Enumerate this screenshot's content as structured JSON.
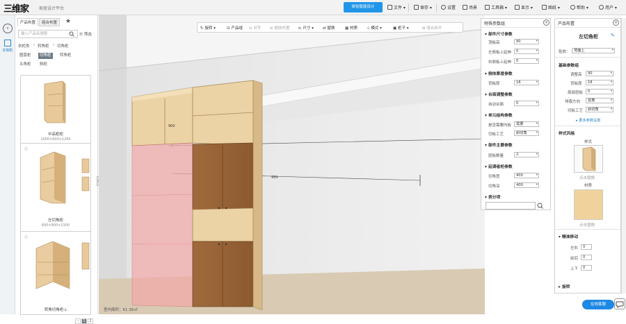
{
  "app": {
    "logo": "三维家",
    "subtitle": "家居设计平台",
    "cta": "体验智能设计"
  },
  "menu": [
    {
      "label": "文件"
    },
    {
      "label": "保存"
    },
    {
      "label": "设置"
    },
    {
      "label": "场景"
    },
    {
      "label": "工具箱"
    },
    {
      "label": "显示"
    },
    {
      "label": "图纸"
    },
    {
      "label": "帮助"
    },
    {
      "label": "用户"
    }
  ],
  "rail": {
    "item": "定制柜"
  },
  "catalog": {
    "tabs": [
      "产品布置",
      "组合布置"
    ],
    "search_placeholder": "输入产品名搜索",
    "filter_label": "筛选",
    "breadcrumb": [
      "衣柜类",
      "转角柜",
      "切角柜"
    ],
    "chips": [
      "圆弧柜",
      "切角柜",
      "转角柜",
      "五角柜",
      "斜柜"
    ],
    "cards": [
      {
        "name": "中高柜柜",
        "dims": "1000×600×1260"
      },
      {
        "name": "左切角柜",
        "dims": "600×600×1300"
      },
      {
        "name": "转角切角柜-L",
        "dims": ""
      }
    ],
    "pages": [
      "1",
      "2"
    ]
  },
  "toolbar": {
    "items": [
      "旋转",
      "产品组",
      "对齐",
      "缩放布置",
      "尺寸",
      "替换",
      "材质",
      "模式",
      "柜子",
      "组合拆开"
    ]
  },
  "scene": {
    "status": "室内面积：61.36㎡",
    "labels": [
      "900",
      "950"
    ]
  },
  "params": {
    "title": "特殊参数组",
    "sections": [
      {
        "name": "部件尺寸参数",
        "rows": [
          {
            "label": "顶板高",
            "value": "90"
          },
          {
            "label": "左侧板上延伸",
            "value": "0"
          },
          {
            "label": "右侧板上延伸",
            "value": "0"
          }
        ]
      },
      {
        "name": "侧体厚度参数",
        "rows": [
          {
            "label": "背板厚",
            "value": "18"
          }
        ]
      },
      {
        "name": "台面调整参数",
        "rows": [
          {
            "label": "自动台面",
            "value": "0"
          }
        ]
      },
      {
        "name": "单元结构参数",
        "rows": [
          {
            "label": "是否需要内板",
            "value": "需要"
          },
          {
            "label": "切板工艺",
            "value": "斜切角"
          }
        ]
      },
      {
        "name": "部件主要参数",
        "rows": [
          {
            "label": "层板数量",
            "value": "2"
          }
        ]
      },
      {
        "name": "延调者柜参数",
        "rows": [
          {
            "label": "切角宽",
            "value": "400"
          },
          {
            "label": "切角深",
            "value": "400"
          }
        ]
      },
      {
        "name": "表分项",
        "rows": []
      }
    ]
  },
  "product": {
    "title": "产品布置",
    "name": "左切角柜",
    "mount_label": "贴放：",
    "mount_value": "地面上",
    "basic_title": "基础参数组",
    "basic_rows": [
      {
        "label": "调整高",
        "value": "90"
      },
      {
        "label": "背板厚",
        "value": "18"
      },
      {
        "label": "局部层板",
        "value": "0"
      },
      {
        "label": "排版方向",
        "value": "竖着"
      },
      {
        "label": "切板工艺",
        "value": "斜切角"
      }
    ],
    "more": "更多参数设置",
    "style_title": "样式风格",
    "style_label": "样式",
    "style_action": "点击替换",
    "material_label": "材质",
    "material_action": "点击替换",
    "move_title": "精准移动",
    "move_rows": [
      {
        "label": "左右",
        "value": "0"
      },
      {
        "label": "前后",
        "value": "0"
      },
      {
        "label": "上下",
        "value": "0"
      }
    ],
    "footer": "旋转"
  },
  "help": "在线客服"
}
